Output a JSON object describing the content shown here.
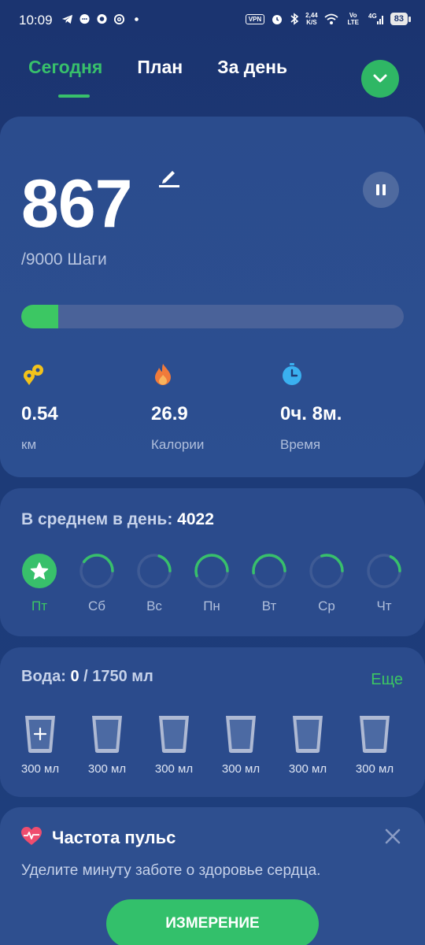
{
  "status_bar": {
    "time": "10:09",
    "vpn": "VPN",
    "speed_value": "2,44",
    "speed_unit": "K/S",
    "volte": "Vo LTE",
    "network": "4G",
    "battery": "83"
  },
  "tabs": [
    {
      "label": "Сегодня",
      "active": true
    },
    {
      "label": "План",
      "active": false
    },
    {
      "label": "За день",
      "active": false
    }
  ],
  "steps": {
    "value": "867",
    "goal_text": "/9000 Шаги",
    "progress_fraction": 0.0963
  },
  "metrics": [
    {
      "icon": "distance-icon",
      "value": "0.54",
      "label": "км"
    },
    {
      "icon": "calories-flame-icon",
      "value": "26.9",
      "label": "Калории"
    },
    {
      "icon": "timer-icon",
      "value": "0ч. 8м.",
      "label": "Время"
    }
  ],
  "daily_average": {
    "label": "В среднем в день:",
    "value": "4022",
    "days": [
      {
        "label": "Пт",
        "today": true,
        "fraction": 1.0
      },
      {
        "label": "Сб",
        "today": false,
        "fraction": 0.4
      },
      {
        "label": "Вс",
        "today": false,
        "fraction": 0.2
      },
      {
        "label": "Пн",
        "today": false,
        "fraction": 0.55
      },
      {
        "label": "Вт",
        "today": false,
        "fraction": 0.52
      },
      {
        "label": "Ср",
        "today": false,
        "fraction": 0.3
      },
      {
        "label": "Чт",
        "today": false,
        "fraction": 0.18
      }
    ]
  },
  "water": {
    "label": "Вода:",
    "current": "0",
    "goal": "/ 1750 мл",
    "more_label": "Еще",
    "cups": [
      {
        "label": "300 мл",
        "add": true
      },
      {
        "label": "300 мл",
        "add": false
      },
      {
        "label": "300 мл",
        "add": false
      },
      {
        "label": "300 мл",
        "add": false
      },
      {
        "label": "300 мл",
        "add": false
      },
      {
        "label": "300 мл",
        "add": false
      }
    ]
  },
  "pulse": {
    "title": "Частота пульс",
    "text": "Уделите минуту заботе о здоровье сердца.",
    "button_label": "ИЗМЕРЕНИЕ"
  },
  "colors": {
    "accent": "#38c06b",
    "background": "#1d3b78",
    "card": "#2b4b8c"
  }
}
